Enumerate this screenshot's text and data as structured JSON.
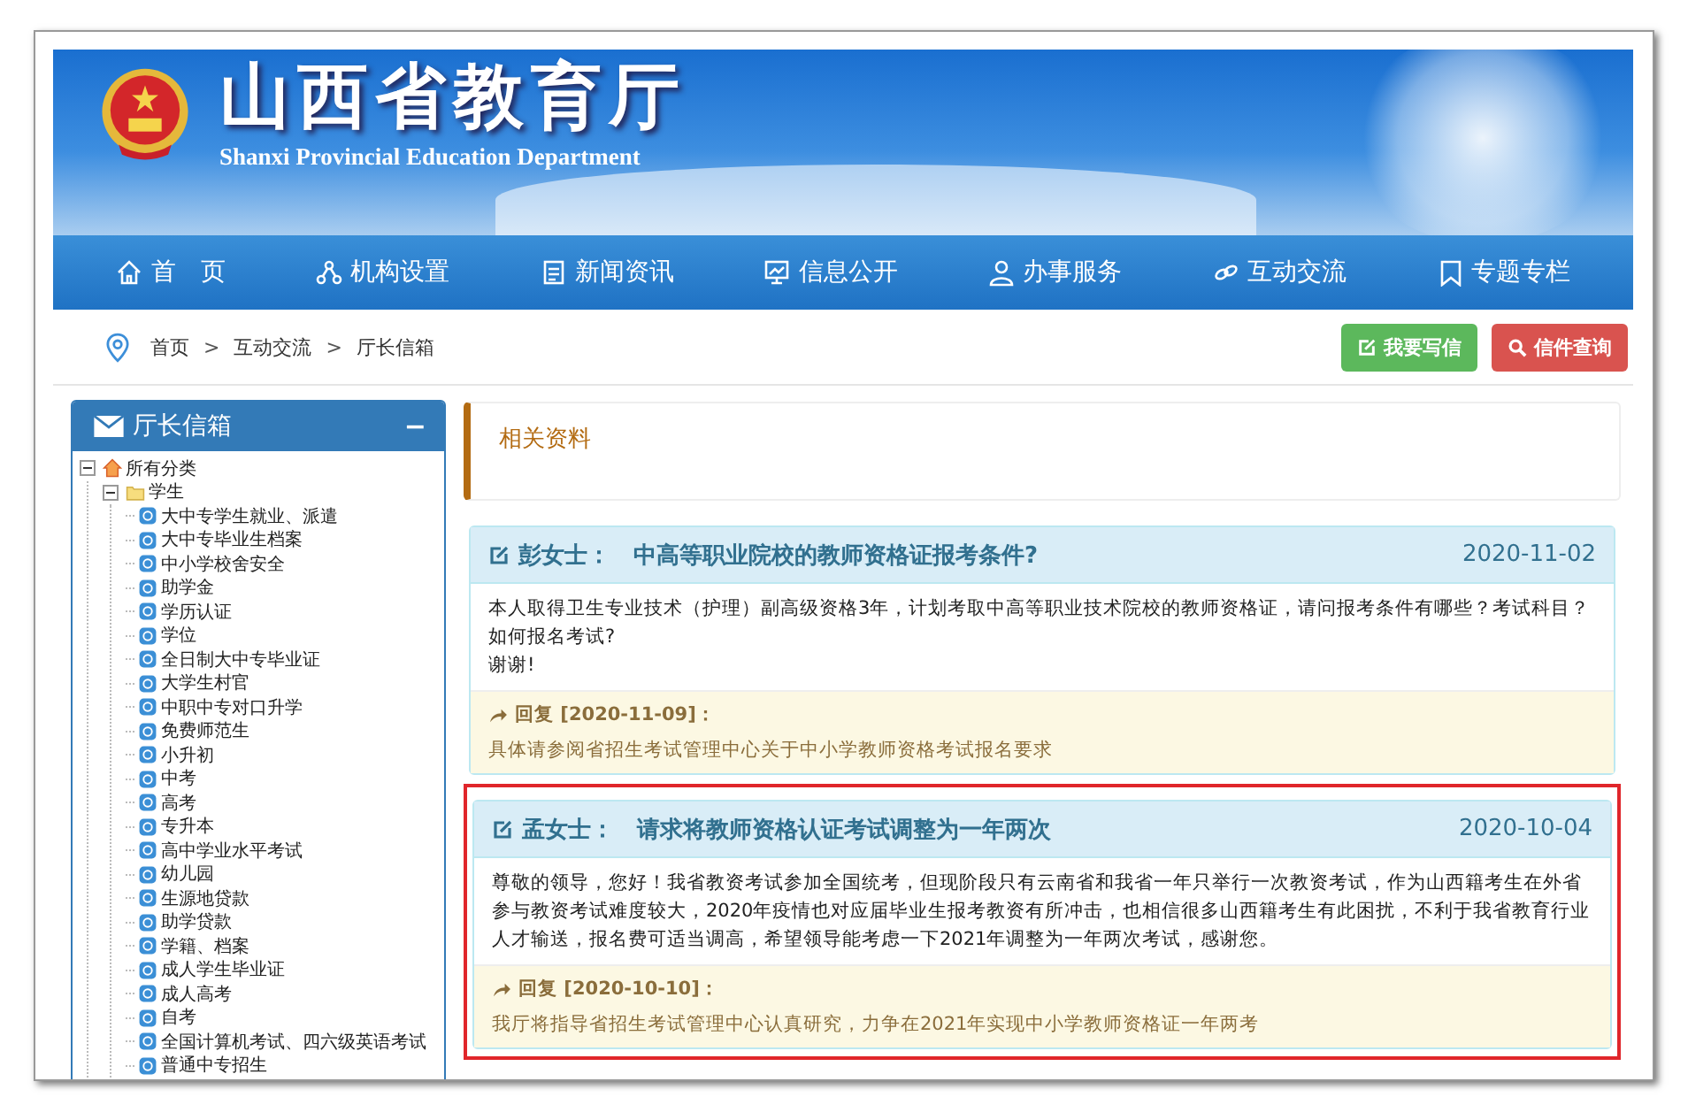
{
  "header": {
    "title": "山西省教育厅",
    "subtitle": "Shanxi Provincial Education Department"
  },
  "nav": [
    {
      "label": "首　页",
      "kind": "home"
    },
    {
      "label": "机构设置",
      "kind": "org"
    },
    {
      "label": "新闻资讯",
      "kind": "news"
    },
    {
      "label": "信息公开",
      "kind": "info"
    },
    {
      "label": "办事服务",
      "kind": "service"
    },
    {
      "label": "互动交流",
      "kind": "link"
    },
    {
      "label": "专题专栏",
      "kind": "topic"
    }
  ],
  "breadcrumb": [
    "首页",
    "互动交流",
    "厅长信箱"
  ],
  "breadcrumb_separator": ">",
  "actions": [
    {
      "label": "我要写信",
      "kind": "write"
    },
    {
      "label": "信件查询",
      "kind": "search"
    }
  ],
  "sidebar": {
    "title": "厅长信箱",
    "collapse_symbol": "−",
    "tree": [
      {
        "label": "所有分类",
        "kind": "home",
        "expanded": true,
        "children": [
          {
            "label": "学生",
            "kind": "folder",
            "expanded": true,
            "children": [
              {
                "label": "大中专学生就业、派遣"
              },
              {
                "label": "大中专毕业生档案"
              },
              {
                "label": "中小学校舍安全"
              },
              {
                "label": "助学金"
              },
              {
                "label": "学历认证"
              },
              {
                "label": "学位"
              },
              {
                "label": "全日制大中专毕业证"
              },
              {
                "label": "大学生村官"
              },
              {
                "label": "中职中专对口升学"
              },
              {
                "label": "免费师范生"
              },
              {
                "label": "小升初"
              },
              {
                "label": "中考"
              },
              {
                "label": "高考"
              },
              {
                "label": "专升本"
              },
              {
                "label": "高中学业水平考试"
              },
              {
                "label": "幼儿园"
              },
              {
                "label": "生源地贷款"
              },
              {
                "label": "助学贷款"
              },
              {
                "label": "学籍、档案"
              },
              {
                "label": "成人学生毕业证"
              },
              {
                "label": "成人高考"
              },
              {
                "label": "自考"
              },
              {
                "label": "全国计算机考试、四六级英语考试"
              },
              {
                "label": "普通中专招生"
              }
            ]
          }
        ]
      }
    ]
  },
  "related": {
    "title": "相关资料"
  },
  "letters": [
    {
      "author": "彭女士：",
      "subject": "中高等职业院校的教师资格证报考条件?",
      "date": "2020-11-02",
      "highlighted": false,
      "body": [
        "本人取得卫生专业技术（护理）副高级资格3年，计划考取中高等职业技术院校的教师资格证，请问报考条件有哪些？考试科目？如何报名考试?",
        "谢谢!"
      ],
      "reply_label": "回复 [2020-11-09]：",
      "reply": "具体请参阅省招生考试管理中心关于中小学教师资格考试报名要求"
    },
    {
      "author": "孟女士：",
      "subject": "请求将教师资格认证考试调整为一年两次",
      "date": "2020-10-04",
      "highlighted": true,
      "body": [
        "尊敬的领导，您好！我省教资考试参加全国统考，但现阶段只有云南省和我省一年只举行一次教资考试，作为山西籍考生在外省参与教资考试难度较大，2020年疫情也对应届毕业生报考教资有所冲击，也相信很多山西籍考生有此困扰，不利于我省教育行业人才输送，报名费可适当调高，希望领导能考虑一下2021年调整为一年两次考试，感谢您。"
      ],
      "reply_label": "回复 [2020-10-10]：",
      "reply": "我厅将指导省招生考试管理中心认真研究，力争在2021年实现中小学教师资格证一年两考"
    }
  ]
}
